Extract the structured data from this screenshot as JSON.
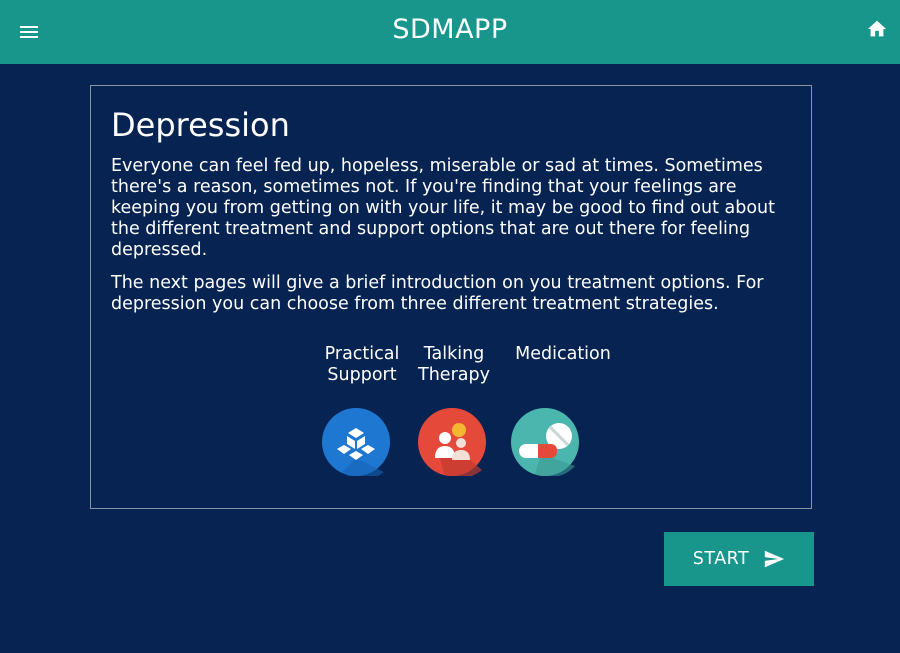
{
  "header": {
    "title": "SDMAPP",
    "menu_icon": "menu-icon",
    "home_icon": "home-icon",
    "background": "#18968c"
  },
  "page": {
    "background": "#062351"
  },
  "card": {
    "heading": "Depression",
    "paragraph_1": "Everyone can feel fed up, hopeless, miserable or sad at times. Sometimes there's a reason, sometimes not. If you're finding that your feelings are keeping you from getting on with your life, it may be good to find out about the different treatment and support options that are out there for feeling depressed.",
    "paragraph_2": "The next pages will give a brief introduction on you treatment options. For depression you can choose from three different treatment strategies."
  },
  "options": [
    {
      "label_line1": "Practical",
      "label_line2": "Support",
      "icon": "practical-support-icon",
      "color": "#1e78d2"
    },
    {
      "label_line1": "Talking",
      "label_line2": "Therapy",
      "icon": "talking-therapy-icon",
      "color": "#e5493a"
    },
    {
      "label_line1": "Medication",
      "label_line2": "",
      "icon": "medication-icon",
      "color": "#4bb6ad"
    }
  ],
  "start_button": {
    "label": "START",
    "icon": "send-icon"
  }
}
